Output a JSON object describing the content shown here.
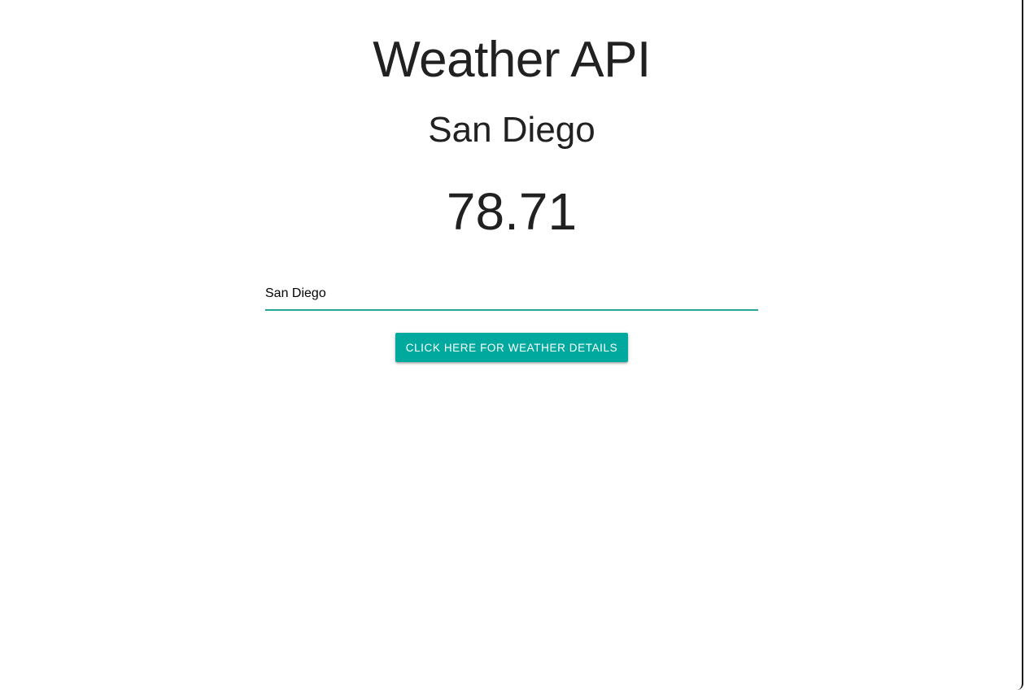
{
  "app": {
    "title": "Weather API"
  },
  "weather": {
    "city": "San Diego",
    "temperature": "78.71"
  },
  "search": {
    "value": "San Diego"
  },
  "actions": {
    "details_label": "Click here for weather details"
  },
  "colors": {
    "accent": "#26a69a",
    "button": "#00a99d",
    "text": "#212121"
  }
}
